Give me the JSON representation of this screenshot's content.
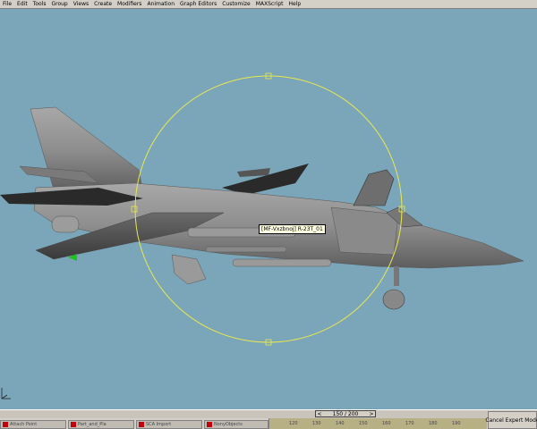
{
  "menu": [
    "File",
    "Edit",
    "Tools",
    "Group",
    "Views",
    "Create",
    "Modifiers",
    "Animation",
    "Graph Editors",
    "Customize",
    "MAXScript",
    "Help"
  ],
  "viewport": {
    "object_label": "[MF-Vxzbnoj] R-23T_01",
    "background": "#7ba6b9",
    "selection_color": "#e8e850",
    "model_color": "#8e8e8e"
  },
  "timeslider": {
    "value": "150 / 200",
    "prev_arrow": "<",
    "next_arrow": ">"
  },
  "taskbar": {
    "items": [
      "Attach Point",
      "Part_and_Pla",
      "SCA Import",
      "NonyObjects"
    ]
  },
  "track": {
    "ticks": [
      "120",
      "130",
      "140",
      "150",
      "160",
      "170",
      "180",
      "190"
    ]
  },
  "cancel_expert_mode": "Cancel Expert Mode"
}
